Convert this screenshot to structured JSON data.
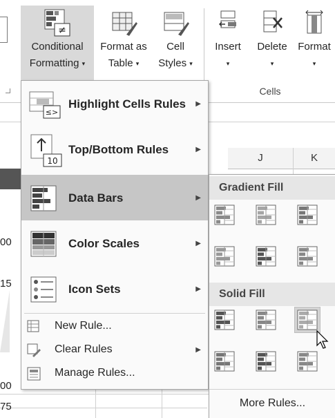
{
  "ribbon": {
    "conditional_formatting": {
      "line1": "Conditional",
      "line2": "Formatting",
      "dropdown": "▾"
    },
    "format_as_table": {
      "line1": "Format as",
      "line2": "Table",
      "dropdown": "▾"
    },
    "cell_styles": {
      "line1": "Cell",
      "line2": "Styles",
      "dropdown": "▾"
    },
    "insert": {
      "label": "Insert",
      "dropdown": "▾"
    },
    "delete": {
      "label": "Delete",
      "dropdown": "▾"
    },
    "format": {
      "label": "Format",
      "dropdown": "▾"
    },
    "cells_group_label": "Cells"
  },
  "sheet": {
    "columns": [
      "J",
      "K"
    ],
    "row_values": [
      "00",
      "15",
      "00",
      "75"
    ]
  },
  "menu": {
    "items": [
      {
        "label": "Highlight Cells Rules",
        "icon": "highlight-cells-icon",
        "submenu": true
      },
      {
        "label": "Top/Bottom Rules",
        "icon": "top-bottom-icon",
        "submenu": true,
        "badge": "10"
      },
      {
        "label": "Data Bars",
        "icon": "data-bars-icon",
        "submenu": true,
        "selected": true
      },
      {
        "label": "Color Scales",
        "icon": "color-scales-icon",
        "submenu": true
      },
      {
        "label": "Icon Sets",
        "icon": "icon-sets-icon",
        "submenu": true
      }
    ],
    "actions": [
      {
        "label": "New Rule...",
        "icon": "new-rule-icon"
      },
      {
        "label": "Clear Rules",
        "icon": "clear-rules-icon",
        "submenu": true
      },
      {
        "label": "Manage Rules...",
        "icon": "manage-rules-icon"
      }
    ],
    "highlight_symbol": "≤>",
    "arrow_glyph": "▶"
  },
  "submenu": {
    "gradient_header": "Gradient Fill",
    "solid_header": "Solid Fill",
    "more_rules": "More Rules..."
  }
}
